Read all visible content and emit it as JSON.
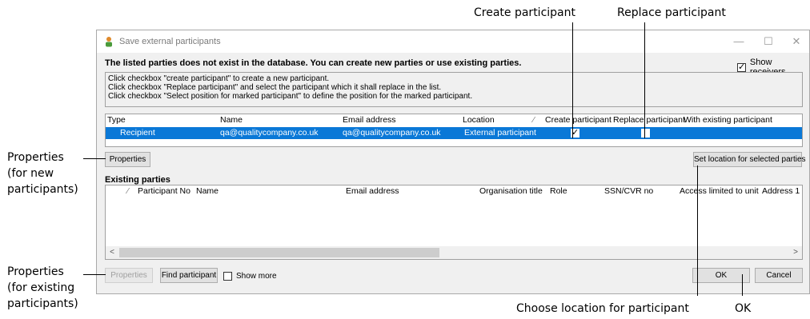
{
  "callouts": {
    "create_participant": "Create participant",
    "replace_participant": "Replace participant",
    "properties_new": [
      "Properties",
      "(for new",
      "participants)"
    ],
    "properties_existing": [
      "Properties",
      "(for existing",
      "participants)"
    ],
    "choose_location": "Choose location for participant",
    "ok": "OK"
  },
  "window": {
    "title": "Save external participants",
    "controls": {
      "minimize": "—",
      "maximize": "☐",
      "close": "✕"
    }
  },
  "intro_text": "The listed parties does not exist in the database. You can create new parties or use existing parties.",
  "show_receivers": {
    "label": "Show receivers",
    "checked": true
  },
  "info_lines": [
    "Click checkbox \"create participant\" to create a new participant.",
    "Click checkbox \"Replace participant\" and select the participant which it shall replace in the list.",
    "Click checkbox \"Select position for marked participant\" to define the position for the marked participant."
  ],
  "parties_table": {
    "headers": {
      "type": "Type",
      "name": "Name",
      "email": "Email address",
      "location": "Location",
      "sort_mark": "⁄",
      "create": "Create participant",
      "replace": "Replace participant",
      "existing": "With existing participant"
    },
    "row": {
      "type": "Recipient",
      "name": "qa@qualitycompany.co.uk",
      "email": "qa@qualitycompany.co.uk",
      "location": "External participant",
      "create_checked": true,
      "replace_checked": false
    }
  },
  "buttons": {
    "properties_new": "Properties",
    "set_location": "Set location for selected parties",
    "properties_existing": "Properties",
    "find_participant": "Find participant",
    "ok": "OK",
    "cancel": "Cancel"
  },
  "existing_parties": {
    "label": "Existing parties",
    "headers": {
      "sort_mark": "⁄",
      "participant_no": "Participant No",
      "name": "Name",
      "email": "Email address",
      "org_title": "Organisation title",
      "role": "Role",
      "ssn": "SSN/CVR no",
      "access": "Access limited to unit",
      "address": "Address 1"
    },
    "scroll_left": "<",
    "scroll_right": ">"
  },
  "show_more": {
    "label": "Show more",
    "checked": false
  },
  "colors": {
    "selection": "#0a78d7",
    "window_bg": "#f0f0f0"
  }
}
